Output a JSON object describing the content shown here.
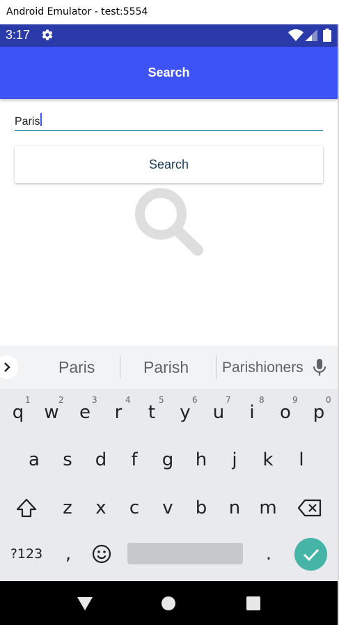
{
  "window": {
    "title": "Android Emulator - test:5554"
  },
  "status_bar": {
    "time": "3:17",
    "icons": [
      "gear-icon",
      "wifi-icon",
      "signal-icon",
      "battery-icon"
    ]
  },
  "app_bar": {
    "title": "Search"
  },
  "search": {
    "value": "Paris",
    "button_label": "Search"
  },
  "keyboard": {
    "suggestions": [
      "Paris",
      "Parish",
      "Parishioners"
    ],
    "row1": [
      "q",
      "w",
      "e",
      "r",
      "t",
      "y",
      "u",
      "i",
      "o",
      "p"
    ],
    "row1_hints": [
      "1",
      "2",
      "3",
      "4",
      "5",
      "6",
      "7",
      "8",
      "9",
      "0"
    ],
    "row2": [
      "a",
      "s",
      "d",
      "f",
      "g",
      "h",
      "j",
      "k",
      "l"
    ],
    "row3": [
      "z",
      "x",
      "c",
      "v",
      "b",
      "n",
      "m"
    ],
    "symbols_label": "?123",
    "comma": ",",
    "period": ".",
    "colors": {
      "enter": "#47b4a8",
      "background": "#e8eaed"
    }
  },
  "colors": {
    "app_bar": "#3d53f5",
    "status_bar": "#2a3aa8",
    "accent_underline": "#1e7fb0"
  }
}
